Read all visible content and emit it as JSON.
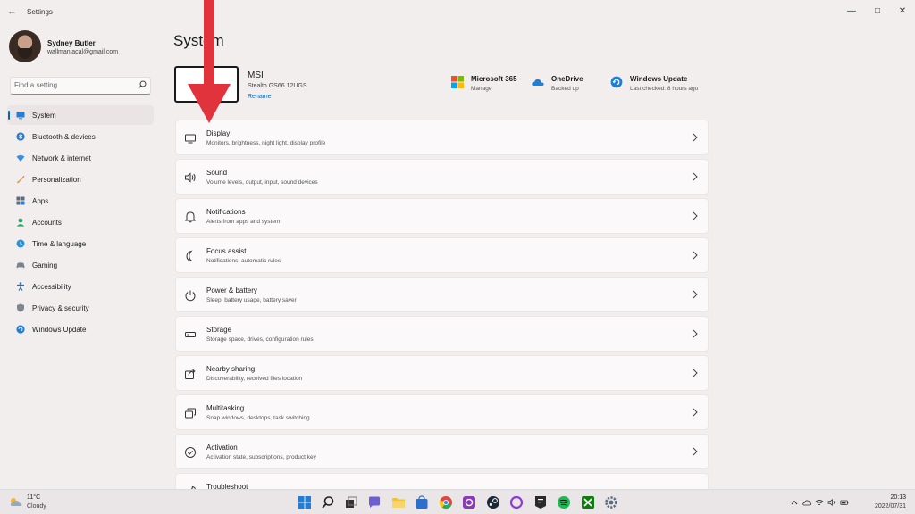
{
  "window": {
    "title": "Settings",
    "back_glyph": "←",
    "minimize_glyph": "—",
    "maximize_glyph": "□",
    "close_glyph": "✕"
  },
  "profile": {
    "name": "Sydney Butler",
    "email": "wallmaniacal@gmail.com"
  },
  "search": {
    "placeholder": "Find a setting",
    "icon": "search-icon"
  },
  "sidebar": {
    "items": [
      {
        "label": "System",
        "icon": "monitor-icon",
        "active": true
      },
      {
        "label": "Bluetooth & devices",
        "icon": "bluetooth-icon"
      },
      {
        "label": "Network & internet",
        "icon": "wifi-icon"
      },
      {
        "label": "Personalization",
        "icon": "brush-icon"
      },
      {
        "label": "Apps",
        "icon": "apps-icon"
      },
      {
        "label": "Accounts",
        "icon": "person-icon"
      },
      {
        "label": "Time & language",
        "icon": "globe-clock-icon"
      },
      {
        "label": "Gaming",
        "icon": "controller-icon"
      },
      {
        "label": "Accessibility",
        "icon": "accessibility-icon"
      },
      {
        "label": "Privacy & security",
        "icon": "shield-icon"
      },
      {
        "label": "Windows Update",
        "icon": "update-icon"
      }
    ]
  },
  "main": {
    "title": "System",
    "device": {
      "name": "MSI",
      "model": "Stealth GS66 12UGS",
      "rename_label": "Rename"
    },
    "status": [
      {
        "title": "Microsoft 365",
        "subtitle": "Manage",
        "icon": "microsoft-logo-icon"
      },
      {
        "title": "OneDrive",
        "subtitle": "Backed up",
        "icon": "cloud-icon"
      },
      {
        "title": "Windows Update",
        "subtitle": "Last checked: 8 hours ago",
        "icon": "update-icon"
      }
    ],
    "settings": [
      {
        "title": "Display",
        "subtitle": "Monitors, brightness, night light, display profile",
        "icon": "display-icon"
      },
      {
        "title": "Sound",
        "subtitle": "Volume levels, output, input, sound devices",
        "icon": "speaker-icon"
      },
      {
        "title": "Notifications",
        "subtitle": "Alerts from apps and system",
        "icon": "bell-icon"
      },
      {
        "title": "Focus assist",
        "subtitle": "Notifications, automatic rules",
        "icon": "moon-icon"
      },
      {
        "title": "Power & battery",
        "subtitle": "Sleep, battery usage, battery saver",
        "icon": "power-icon"
      },
      {
        "title": "Storage",
        "subtitle": "Storage space, drives, configuration rules",
        "icon": "storage-icon"
      },
      {
        "title": "Nearby sharing",
        "subtitle": "Discoverability, received files location",
        "icon": "share-icon"
      },
      {
        "title": "Multitasking",
        "subtitle": "Snap windows, desktops, task switching",
        "icon": "multitask-icon"
      },
      {
        "title": "Activation",
        "subtitle": "Activation state, subscriptions, product key",
        "icon": "checkmark-circle-icon"
      },
      {
        "title": "Troubleshoot",
        "subtitle": "",
        "icon": "wrench-icon"
      }
    ]
  },
  "taskbar": {
    "weather": {
      "temp": "11°C",
      "condition": "Cloudy",
      "icon": "cloud-sun-icon"
    },
    "apps": [
      {
        "name": "start-icon",
        "color": "#1f7ed6"
      },
      {
        "name": "search-icon",
        "color": "#222222"
      },
      {
        "name": "task-view-icon",
        "color": "#333333"
      },
      {
        "name": "chat-icon",
        "color": "#6b5fd3"
      },
      {
        "name": "file-explorer-icon",
        "color": "#f2c230"
      },
      {
        "name": "store-icon",
        "color": "#2b6fcf"
      },
      {
        "name": "chrome-icon",
        "color": "#e2453c"
      },
      {
        "name": "app-icon",
        "color": "#8a3ab9"
      },
      {
        "name": "steam-icon",
        "color": "#1b2838"
      },
      {
        "name": "cortana-icon",
        "color": "#8e3bd6"
      },
      {
        "name": "epic-games-icon",
        "color": "#2a2a2a"
      },
      {
        "name": "spotify-icon",
        "color": "#1db954"
      },
      {
        "name": "xbox-icon",
        "color": "#107c10"
      },
      {
        "name": "settings-icon",
        "color": "#5a6b7d"
      }
    ],
    "clock": {
      "time": "20:13",
      "date": "2022/07/31"
    }
  }
}
